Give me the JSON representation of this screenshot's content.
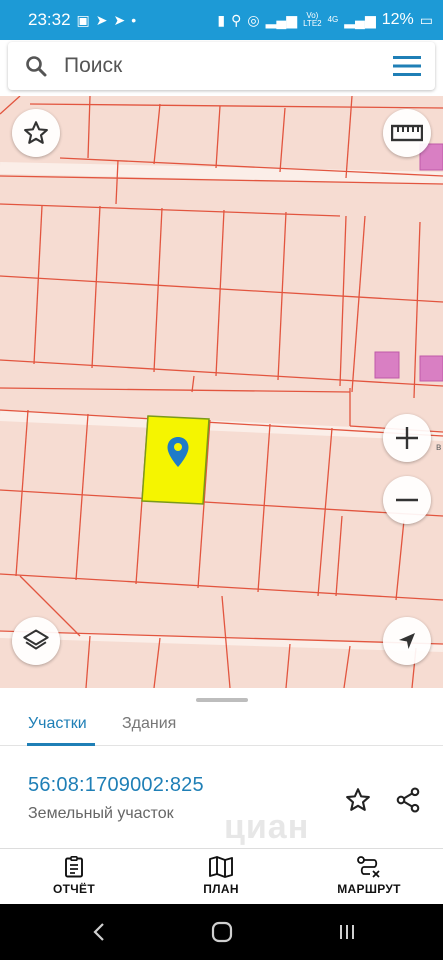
{
  "status_bar": {
    "time": "23:32",
    "signal_text_top": "Vo)",
    "signal_text_bottom": "LTE2",
    "network_type": "4G",
    "battery": "12%"
  },
  "search": {
    "placeholder": "Поиск"
  },
  "map": {
    "edge_label": "в",
    "parcel_fill_color": "#f6dcd2",
    "parcel_border_color": "#e2553f",
    "selected_fill_color": "#f5f500",
    "marker_color": "#1e7bc8"
  },
  "tabs": {
    "active": "Участки",
    "inactive": "Здания"
  },
  "parcel": {
    "cadastral_number": "56:08:1709002:825",
    "type": "Земельный участок"
  },
  "watermark": "циан",
  "bottom_nav": {
    "report": "ОТЧЁТ",
    "plan": "ПЛАН",
    "route": "МАРШРУТ"
  }
}
